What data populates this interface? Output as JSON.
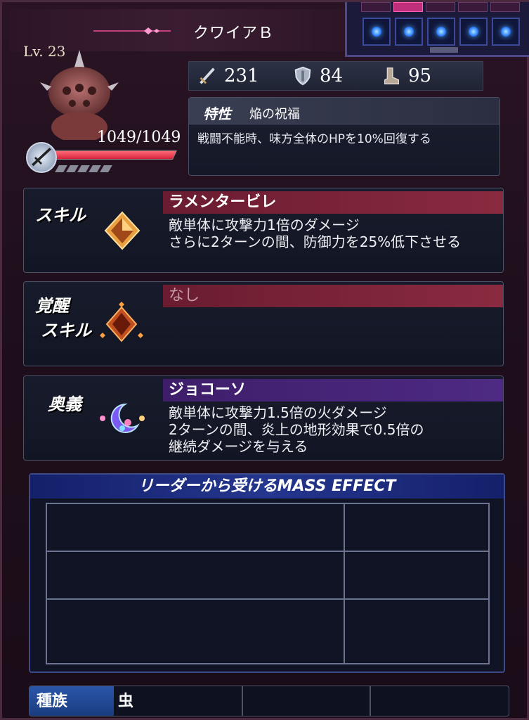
{
  "header": {
    "character_name": "クワイアＢ"
  },
  "party": {
    "slot_count": 5
  },
  "unit": {
    "level_label": "Lv. 23",
    "hp_text": "1049/1049",
    "hp_fraction": 1.0
  },
  "stats": {
    "attack": "231",
    "defense": "84",
    "speed": "95"
  },
  "trait": {
    "label": "特性",
    "name": "焔の祝福",
    "description": "戦闘不能時、味方全体のHPを10%回復する"
  },
  "skill": {
    "label": "スキル",
    "name": "ラメンタービレ",
    "lines": [
      "敵単体に攻撃力1倍のダメージ",
      "さらに2ターンの間、防御力を25%低下させる"
    ]
  },
  "awakened_skill": {
    "label_line1": "覚醒",
    "label_line2": "スキル",
    "name": "なし"
  },
  "ougi": {
    "label": "奥義",
    "name": "ジョコーソ",
    "lines": [
      "敵単体に攻撃力1.5倍の火ダメージ",
      "2ターンの間、炎上の地形効果で0.5倍の",
      "継続ダメージを与える"
    ]
  },
  "mass_effect": {
    "title": "リーダーから受けるMASS EFFECT"
  },
  "race": {
    "label": "種族",
    "value": "虫"
  },
  "colors": {
    "hp_fill": "#d8243c",
    "skill_header": "#8a2a40",
    "ougi_header": "#4e2a84",
    "race_label": "#2a56aa"
  }
}
